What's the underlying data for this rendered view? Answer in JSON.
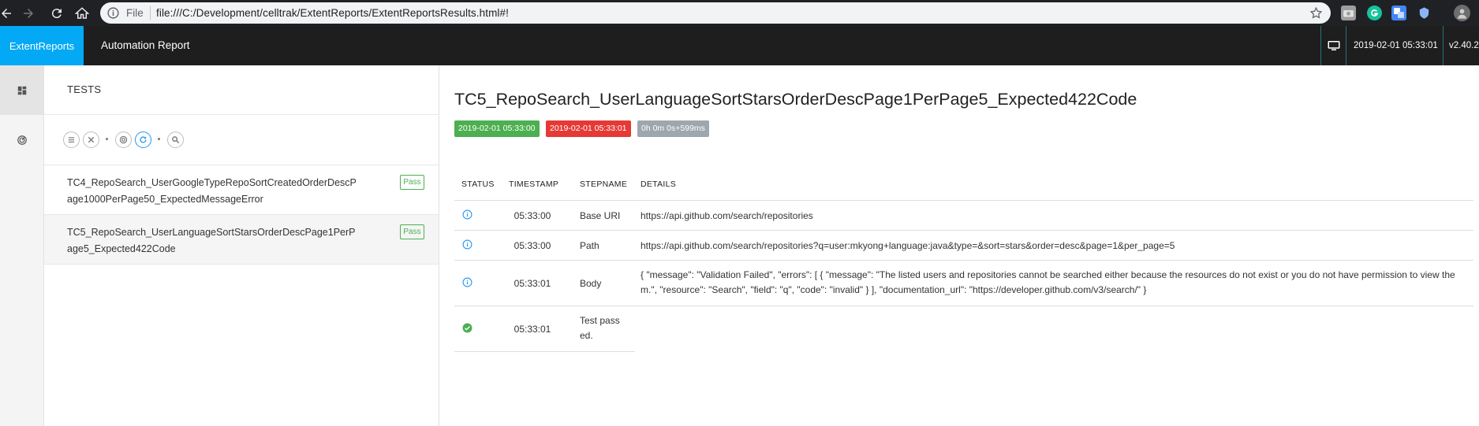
{
  "browser": {
    "omnibox_file_label": "File",
    "url": "file:///C:/Development/celltrak/ExtentReports/ExtentReportsResults.html#!"
  },
  "topbar": {
    "brand": "ExtentReports",
    "report_name": "Automation Report",
    "timestamp": "2019-02-01 05:33:01",
    "version": "v2.40.2"
  },
  "test_list": {
    "heading": "TESTS",
    "filters": [
      "list-icon",
      "close-icon",
      "dashboard-icon",
      "refresh-icon",
      "search-icon"
    ],
    "tests": [
      {
        "name": "TC4_RepoSearch_UserGoogleTypeRepoSortCreatedOrderDescPage1000PerPage50_ExpectedMessageError",
        "status": "Pass"
      },
      {
        "name": "TC5_RepoSearch_UserLanguageSortStarsOrderDescPage1PerPage5_Expected422Code",
        "status": "Pass"
      }
    ]
  },
  "detail": {
    "title": "TC5_RepoSearch_UserLanguageSortStarsOrderDescPage1PerPage5_Expected422Code",
    "start_time": "2019-02-01 05:33:00",
    "end_time": "2019-02-01 05:33:01",
    "duration": "0h 0m 0s+599ms",
    "columns": [
      "STATUS",
      "TIMESTAMP",
      "STEPNAME",
      "DETAILS"
    ],
    "steps": [
      {
        "status": "info",
        "timestamp": "05:33:00",
        "stepname": "Base URI",
        "details": "https://api.github.com/search/repositories"
      },
      {
        "status": "info",
        "timestamp": "05:33:00",
        "stepname": "Path",
        "details": "https://api.github.com/search/repositories?q=user:mkyong+language:java&type=&sort=stars&order=desc&page=1&per_page=5"
      },
      {
        "status": "info",
        "timestamp": "05:33:01",
        "stepname": "Body",
        "details": "{ \"message\": \"Validation Failed\", \"errors\": [ { \"message\": \"The listed users and repositories cannot be searched either because the resources do not exist or you do not have permission to view them.\", \"resource\": \"Search\", \"field\": \"q\", \"code\": \"invalid\" } ], \"documentation_url\": \"https://developer.github.com/v3/search/\" }"
      },
      {
        "status": "pass",
        "timestamp": "05:33:01",
        "stepname": "Test passed.",
        "details": ""
      }
    ]
  },
  "colors": {
    "brand": "#03a9f4",
    "pass": "#4caf50",
    "fail": "#e53935",
    "info": "#2196f3",
    "neutral": "#9ea7ad"
  }
}
